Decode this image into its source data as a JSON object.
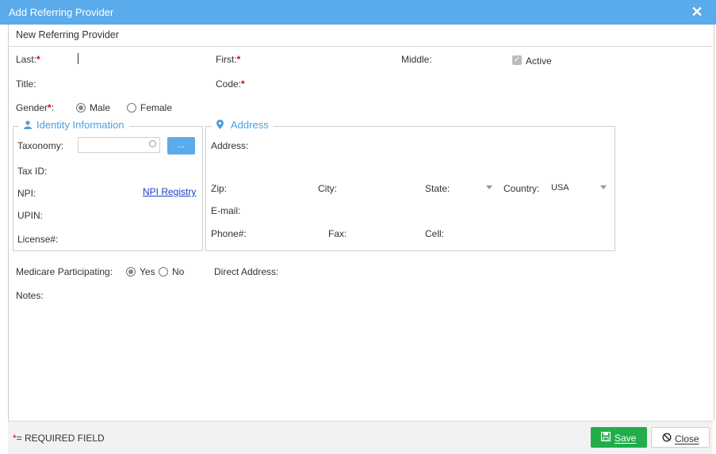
{
  "window": {
    "title": "Add Referring Provider"
  },
  "header": {
    "subtitle": "New Referring Provider"
  },
  "form": {
    "last_label": "Last:",
    "first_label": "First:",
    "middle_label": "Middle:",
    "active_label": "Active",
    "active_checked": true,
    "title_label": "Title:",
    "code_label": "Code:",
    "gender_label": "Gender",
    "gender_colon": ":",
    "gender_options": [
      "Male",
      "Female"
    ],
    "gender_selected": "Male",
    "required_mark": "*",
    "identity": {
      "legend": "Identity Information",
      "taxonomy_label": "Taxonomy:",
      "lookup_button": "...",
      "taxid_label": "Tax ID:",
      "npi_label": "NPI:",
      "npi_registry_link": "NPI Registry",
      "upin_label": "UPIN:",
      "license_label": "License#:"
    },
    "address": {
      "legend": "Address",
      "address_label": "Address:",
      "zip_label": "Zip:",
      "city_label": "City:",
      "state_label": "State:",
      "country_label": "Country:",
      "country_value": "USA",
      "email_label": "E-mail:",
      "phone_label": "Phone#:",
      "fax_label": "Fax:",
      "cell_label": "Cell:"
    },
    "medicare_label": "Medicare Participating:",
    "medicare_options": [
      "Yes",
      "No"
    ],
    "medicare_selected": "Yes",
    "direct_address_label": "Direct Address:",
    "notes_label": "Notes:"
  },
  "footer": {
    "required_note": "= REQUIRED FIELD",
    "save_label": "Save",
    "close_label": "Close"
  },
  "colors": {
    "titlebar": "#5aabeb",
    "accent": "#4a9fe0",
    "save": "#22ad4a",
    "required": "#e00000"
  },
  "icons": [
    "close-icon",
    "user-icon",
    "map-marker-icon",
    "floppy-disk-icon",
    "ban-icon",
    "circle-icon",
    "checkmark-icon"
  ]
}
